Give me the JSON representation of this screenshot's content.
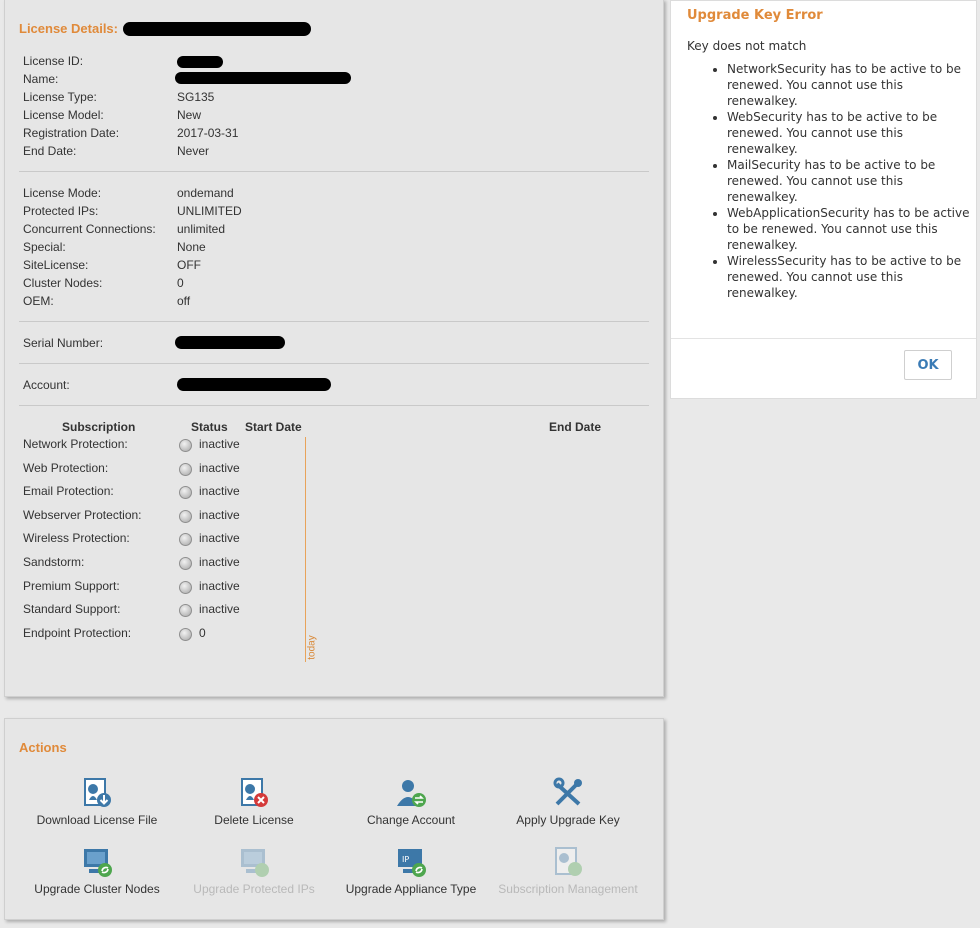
{
  "license_details": {
    "title": "License Details:",
    "rows": [
      {
        "label": "License ID:",
        "value": ""
      },
      {
        "label": "Name:",
        "value": ""
      },
      {
        "label": "License Type:",
        "value": "SG135"
      },
      {
        "label": "License Model:",
        "value": "New"
      },
      {
        "label": "Registration Date:",
        "value": "2017-03-31"
      },
      {
        "label": "End Date:",
        "value": "Never"
      }
    ],
    "mode_rows": [
      {
        "label": "License Mode:",
        "value": "ondemand"
      },
      {
        "label": "Protected IPs:",
        "value": "UNLIMITED"
      },
      {
        "label": "Concurrent Connections:",
        "value": "unlimited"
      },
      {
        "label": "Special:",
        "value": "None"
      },
      {
        "label": "SiteLicense:",
        "value": "OFF"
      },
      {
        "label": "Cluster Nodes:",
        "value": "0"
      },
      {
        "label": "OEM:",
        "value": "off"
      }
    ],
    "serial_label": "Serial Number:",
    "account_label": "Account:",
    "subscriptions": {
      "headers": {
        "subscription": "Subscription",
        "status": "Status",
        "start": "Start Date",
        "end": "End Date"
      },
      "items": [
        {
          "label": "Network Protection:",
          "status": "inactive"
        },
        {
          "label": "Web Protection:",
          "status": "inactive"
        },
        {
          "label": "Email Protection:",
          "status": "inactive"
        },
        {
          "label": "Webserver Protection:",
          "status": "inactive"
        },
        {
          "label": "Wireless Protection:",
          "status": "inactive"
        },
        {
          "label": "Sandstorm:",
          "status": "inactive"
        },
        {
          "label": "Premium Support:",
          "status": "inactive"
        },
        {
          "label": "Standard Support:",
          "status": "inactive"
        },
        {
          "label": "Endpoint Protection:",
          "status": "0"
        }
      ],
      "today_label": "today"
    }
  },
  "actions": {
    "title": "Actions",
    "items": [
      {
        "label": "Download License File",
        "icon": "download-license-icon",
        "enabled": true
      },
      {
        "label": "Delete License",
        "icon": "delete-license-icon",
        "enabled": true
      },
      {
        "label": "Change Account",
        "icon": "change-account-icon",
        "enabled": true
      },
      {
        "label": "Apply Upgrade Key",
        "icon": "tools-icon",
        "enabled": true
      },
      {
        "label": "Upgrade Cluster Nodes",
        "icon": "upgrade-cluster-icon",
        "enabled": true
      },
      {
        "label": "Upgrade Protected IPs",
        "icon": "upgrade-ips-icon",
        "enabled": false
      },
      {
        "label": "Upgrade Appliance Type",
        "icon": "upgrade-appliance-icon",
        "enabled": true
      },
      {
        "label": "Subscription Management",
        "icon": "subscription-icon",
        "enabled": false
      }
    ]
  },
  "dialog": {
    "title": "Upgrade Key Error",
    "message": "Key does not match",
    "errors": [
      "NetworkSecurity has to be active to be renewed. You cannot use this renewalkey.",
      "WebSecurity has to be active to be renewed. You cannot use this renewalkey.",
      "MailSecurity has to be active to be renewed. You cannot use this renewalkey.",
      "WebApplicationSecurity has to be active to be renewed. You cannot use this renewalkey.",
      "WirelessSecurity has to be active to be renewed. You cannot use this renewalkey."
    ],
    "ok_label": "OK"
  },
  "colors": {
    "accent": "#e08a3a",
    "ok_button": "#3a7bb5",
    "today_line": "#e8a35a"
  }
}
